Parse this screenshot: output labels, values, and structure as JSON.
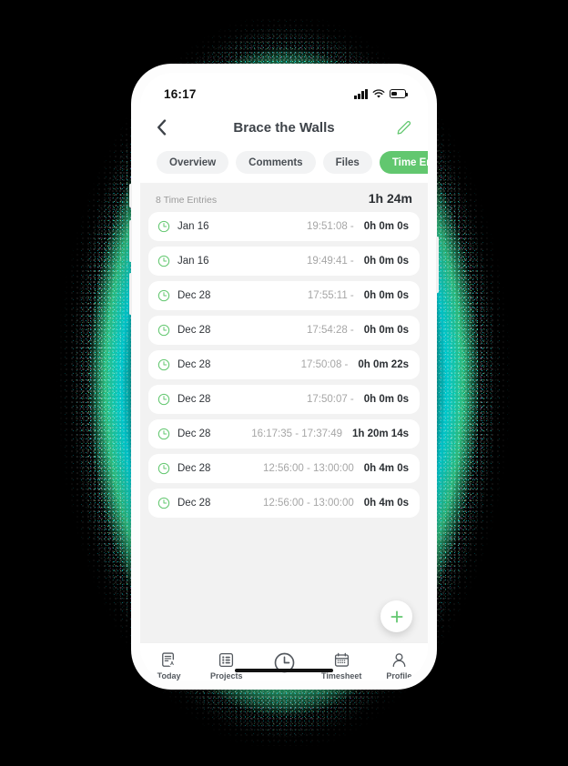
{
  "status_bar": {
    "time": "16:17",
    "signal_icon": "signal-bars-icon",
    "wifi_icon": "wifi-icon",
    "battery_icon": "battery-icon",
    "battery_level_pct": 38
  },
  "header": {
    "back_icon": "chevron-left-icon",
    "title": "Brace the Walls",
    "edit_icon": "pencil-icon"
  },
  "tabs": [
    {
      "label": "Overview",
      "active": false
    },
    {
      "label": "Comments",
      "active": false
    },
    {
      "label": "Files",
      "active": false
    },
    {
      "label": "Time Entries",
      "active": true
    }
  ],
  "summary": {
    "count_label": "8 Time Entries",
    "total_duration": "1h 24m"
  },
  "time_entries": [
    {
      "icon": "clock-icon",
      "date": "Jan 16",
      "range": "19:51:08 -",
      "duration": "0h 0m 0s"
    },
    {
      "icon": "clock-icon",
      "date": "Jan 16",
      "range": "19:49:41 -",
      "duration": "0h 0m 0s"
    },
    {
      "icon": "clock-icon",
      "date": "Dec 28",
      "range": "17:55:11 -",
      "duration": "0h 0m 0s"
    },
    {
      "icon": "clock-icon",
      "date": "Dec 28",
      "range": "17:54:28 -",
      "duration": "0h 0m 0s"
    },
    {
      "icon": "clock-icon",
      "date": "Dec 28",
      "range": "17:50:08 -",
      "duration": "0h 0m 22s"
    },
    {
      "icon": "clock-icon",
      "date": "Dec 28",
      "range": "17:50:07 -",
      "duration": "0h 0m 0s"
    },
    {
      "icon": "clock-icon",
      "date": "Dec 28",
      "range": "16:17:35 - 17:37:49",
      "duration": "1h 20m 14s"
    },
    {
      "icon": "clock-icon",
      "date": "Dec 28",
      "range": "12:56:00 - 13:00:00",
      "duration": "0h 4m 0s"
    },
    {
      "icon": "clock-icon",
      "date": "Dec 28",
      "range": "12:56:00 - 13:00:00",
      "duration": "0h 4m 0s"
    }
  ],
  "fab": {
    "icon": "plus-icon",
    "label": ""
  },
  "tab_bar": [
    {
      "label": "Today",
      "icon": "document-person-icon",
      "active": false
    },
    {
      "label": "Projects",
      "icon": "list-icon",
      "active": false
    },
    {
      "label": "",
      "icon": "clock-icon",
      "active": false
    },
    {
      "label": "Timesheet",
      "icon": "calendar-icon",
      "active": false
    },
    {
      "label": "Profile",
      "icon": "person-icon",
      "active": false
    }
  ],
  "colors": {
    "accent_green": "#62c76f",
    "page_background": "#000000",
    "content_background": "#f2f2f2",
    "card_background": "#ffffff",
    "muted_text": "#a6a6a6",
    "primary_text": "#2b2f33"
  }
}
